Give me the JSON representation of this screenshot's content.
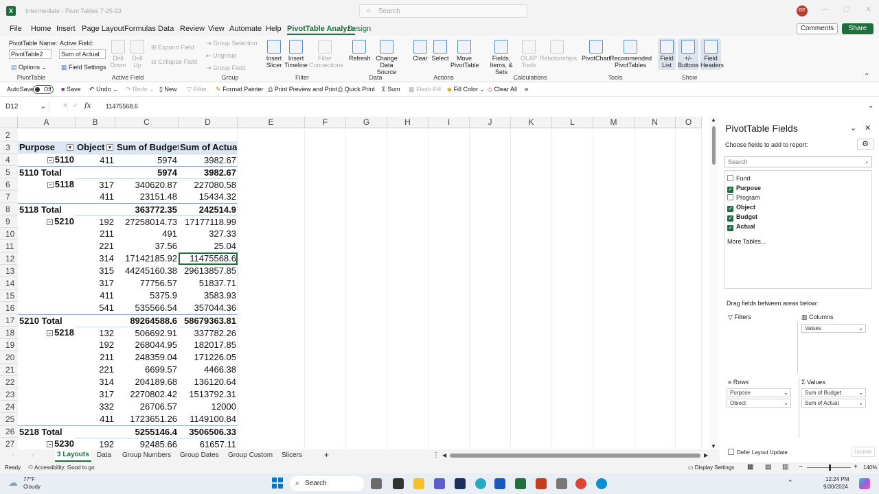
{
  "window": {
    "title": "Intermediate - Pivot Tables 7-25-23",
    "search_placeholder": "Search",
    "avatar": "RP",
    "app_icon": "X"
  },
  "tabs": [
    "File",
    "Home",
    "Insert",
    "Page Layout",
    "Formulas",
    "Data",
    "Review",
    "View",
    "Automate",
    "Help",
    "PivotTable Analyze",
    "Design"
  ],
  "active_tab": "PivotTable Analyze",
  "comments_label": "Comments",
  "share_label": "Share",
  "ribbon": {
    "pt_name_label": "PivotTable Name:",
    "pt_name_value": "PivotTable2",
    "options_label": "Options",
    "group_pivottable": "PivotTable",
    "active_field_label": "Active Field:",
    "active_field_value": "Sum of Actual",
    "field_settings": "Field Settings",
    "drill_down": "Drill Down",
    "drill_up": "Drill Up",
    "expand_field": "Expand Field",
    "collapse_field": "Collapse Field",
    "group_active_field": "Active Field",
    "group_selection": "Group Selection",
    "ungroup": "Ungroup",
    "group_field": "Group Field",
    "group_group": "Group",
    "insert_slicer": "Insert Slicer",
    "insert_timeline": "Insert Timeline",
    "filter_connections": "Filter Connections",
    "group_filter": "Filter",
    "refresh": "Refresh",
    "change_data_source": "Change Data Source",
    "group_data": "Data",
    "clear": "Clear",
    "select": "Select",
    "move_pivottable": "Move PivotTable",
    "group_actions": "Actions",
    "fields_items_sets": "Fields, Items, & Sets",
    "olap_tools": "OLAP Tools",
    "relationships": "Relationships",
    "group_calculations": "Calculations",
    "pivotchart": "PivotChart",
    "recommended_pivottables": "Recommended PivotTables",
    "group_tools": "Tools",
    "field_list": "Field List",
    "buttons": "+/- Buttons",
    "field_headers": "Field Headers",
    "group_show": "Show"
  },
  "qat": {
    "autosave": "AutoSave",
    "off": "Off",
    "save": "Save",
    "undo": "Undo",
    "redo": "Redo",
    "new": "New",
    "filter": "Filter",
    "format_painter": "Format Painter",
    "print_preview": "Print Preview and Print",
    "quick_print": "Quick Print",
    "sum": "Sum",
    "flash_fill": "Flash Fill",
    "fill_color": "Fill Color",
    "clear_all": "Clear All"
  },
  "formula_bar": {
    "name_box": "D12",
    "fx": "fx",
    "value": "11475568.6"
  },
  "columns": [
    "A",
    "B",
    "C",
    "D",
    "E",
    "F",
    "G",
    "H",
    "I",
    "J",
    "K",
    "L",
    "M",
    "N",
    "O"
  ],
  "rows": [
    {
      "n": "2",
      "a": "",
      "b": "",
      "c": "",
      "d": ""
    },
    {
      "n": "3",
      "a": "Purpose",
      "b": "Object",
      "c": "Sum of Budget",
      "d": "Sum of Actual",
      "header": true
    },
    {
      "n": "4",
      "a": "5110",
      "b": "411",
      "c": "5974",
      "d": "3982.67",
      "group": true
    },
    {
      "n": "5",
      "a": "5110 Total",
      "b": "",
      "c": "5974",
      "d": "3982.67",
      "total": true
    },
    {
      "n": "6",
      "a": "5118",
      "b": "317",
      "c": "340620.87",
      "d": "227080.58",
      "group": true
    },
    {
      "n": "7",
      "a": "",
      "b": "411",
      "c": "23151.48",
      "d": "15434.32"
    },
    {
      "n": "8",
      "a": "5118 Total",
      "b": "",
      "c": "363772.35",
      "d": "242514.9",
      "total": true
    },
    {
      "n": "9",
      "a": "5210",
      "b": "192",
      "c": "27258014.73",
      "d": "17177118.99",
      "group": true
    },
    {
      "n": "10",
      "a": "",
      "b": "211",
      "c": "491",
      "d": "327.33"
    },
    {
      "n": "11",
      "a": "",
      "b": "221",
      "c": "37.56",
      "d": "25.04"
    },
    {
      "n": "12",
      "a": "",
      "b": "314",
      "c": "17142185.92",
      "d": "11475568.6"
    },
    {
      "n": "13",
      "a": "",
      "b": "315",
      "c": "44245160.38",
      "d": "29613857.85"
    },
    {
      "n": "14",
      "a": "",
      "b": "317",
      "c": "77756.57",
      "d": "51837.71"
    },
    {
      "n": "15",
      "a": "",
      "b": "411",
      "c": "5375.9",
      "d": "3583.93"
    },
    {
      "n": "16",
      "a": "",
      "b": "541",
      "c": "535566.54",
      "d": "357044.36"
    },
    {
      "n": "17",
      "a": "5210 Total",
      "b": "",
      "c": "89264588.6",
      "d": "58679363.81",
      "total": true
    },
    {
      "n": "18",
      "a": "5218",
      "b": "132",
      "c": "506692.91",
      "d": "337782.26",
      "group": true
    },
    {
      "n": "19",
      "a": "",
      "b": "192",
      "c": "268044.95",
      "d": "182017.85"
    },
    {
      "n": "20",
      "a": "",
      "b": "211",
      "c": "248359.04",
      "d": "171226.05"
    },
    {
      "n": "21",
      "a": "",
      "b": "221",
      "c": "6699.57",
      "d": "4466.38"
    },
    {
      "n": "22",
      "a": "",
      "b": "314",
      "c": "204189.68",
      "d": "136120.64"
    },
    {
      "n": "23",
      "a": "",
      "b": "317",
      "c": "2270802.42",
      "d": "1513792.31"
    },
    {
      "n": "24",
      "a": "",
      "b": "332",
      "c": "26706.57",
      "d": "12000"
    },
    {
      "n": "25",
      "a": "",
      "b": "411",
      "c": "1723651.26",
      "d": "1149100.84"
    },
    {
      "n": "26",
      "a": "5218 Total",
      "b": "",
      "c": "5255146.4",
      "d": "3506506.33",
      "total": true
    },
    {
      "n": "27",
      "a": "5230",
      "b": "192",
      "c": "92485.66",
      "d": "61657.11",
      "group": true
    }
  ],
  "panel": {
    "title": "PivotTable Fields",
    "subtitle": "Choose fields to add to report:",
    "search_placeholder": "Search",
    "fields": [
      {
        "name": "Fund",
        "checked": false
      },
      {
        "name": "Purpose",
        "checked": true
      },
      {
        "name": "Program",
        "checked": false
      },
      {
        "name": "Object",
        "checked": true
      },
      {
        "name": "Budget",
        "checked": true
      },
      {
        "name": "Actual",
        "checked": true
      }
    ],
    "more_tables": "More Tables...",
    "drag_label": "Drag fields between areas below:",
    "filters": "Filters",
    "columns": "Columns",
    "rows": "Rows",
    "values": "Values",
    "columns_items": [
      "Values"
    ],
    "rows_items": [
      "Purpose",
      "Object"
    ],
    "values_items": [
      "Sum of Budget",
      "Sum of Actual"
    ],
    "defer": "Defer Layout Update",
    "update": "Update"
  },
  "sheets": [
    "3 Layouts",
    "Data",
    "Group Numbers",
    "Group Dates",
    "Group Custom",
    "Slicers"
  ],
  "active_sheet": "3 Layouts",
  "status": {
    "ready": "Ready",
    "accessibility": "Accessibility: Good to go",
    "display_settings": "Display Settings",
    "zoom": "140%"
  },
  "taskbar": {
    "weather_temp": "77°F",
    "weather_desc": "Cloudy",
    "search": "Search",
    "time": "12:24 PM",
    "date": "9/30/2024"
  },
  "colors": {
    "excel_green": "#1e6f3c",
    "active_tab": "#1e6f3c",
    "pivot_header": "#dde6f3"
  }
}
